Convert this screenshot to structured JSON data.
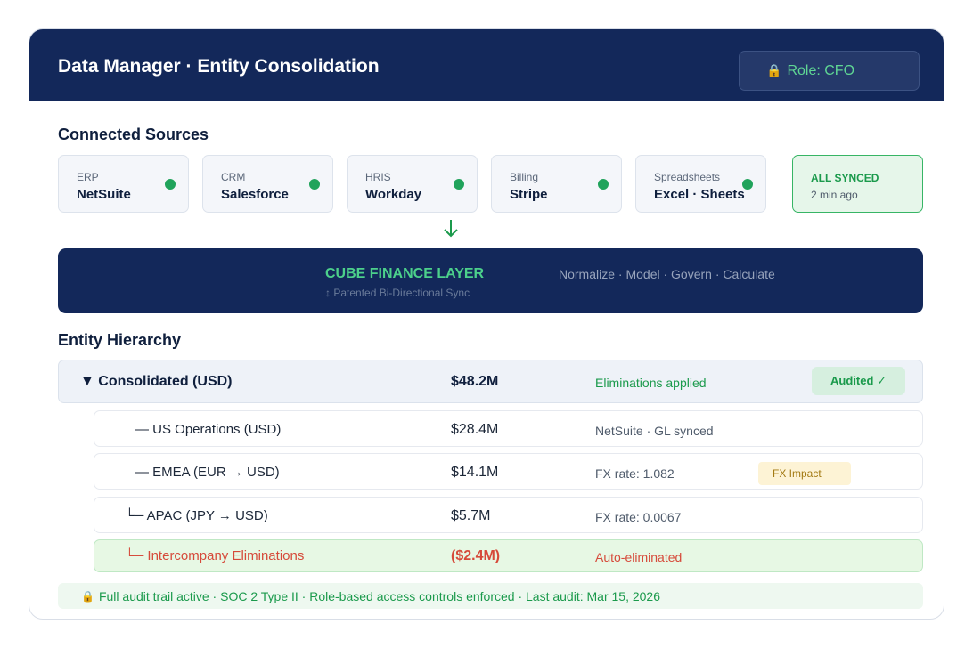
{
  "header": {
    "title": "Data Manager · Entity Consolidation",
    "role_label": "Role: CFO",
    "role_icon": "lock-icon"
  },
  "sources": {
    "title": "Connected Sources",
    "items": [
      {
        "category": "ERP",
        "name": "NetSuite",
        "status": "connected"
      },
      {
        "category": "CRM",
        "name": "Salesforce",
        "status": "connected"
      },
      {
        "category": "HRIS",
        "name": "Workday",
        "status": "connected"
      },
      {
        "category": "Billing",
        "name": "Stripe",
        "status": "connected"
      },
      {
        "category": "Spreadsheets",
        "name": "Excel · Sheets",
        "status": "connected"
      }
    ],
    "sync_status": {
      "title": "ALL SYNCED",
      "time": "2 min ago"
    }
  },
  "cube": {
    "title": "CUBE FINANCE LAYER",
    "subtitle": "↕ Patented Bi-Directional Sync",
    "tagline": "Normalize · Model · Govern · Calculate"
  },
  "hierarchy": {
    "title": "Entity Hierarchy",
    "consolidated": {
      "name": "▼ Consolidated (USD)",
      "value": "$48.2M",
      "note": "Eliminations applied",
      "badge": "Audited ✓"
    },
    "children": [
      {
        "name": "— US Operations (USD)",
        "value": "$28.4M",
        "note": "NetSuite · GL synced"
      },
      {
        "name": "— EMEA (EUR → USD)",
        "value": "$14.1M",
        "note": "FX rate: 1.082",
        "badge": "FX Impact"
      },
      {
        "name": "└─ APAC (JPY → USD)",
        "value": "$5.7M",
        "note": "FX rate: 0.0067"
      }
    ],
    "eliminations": {
      "name": "└─ Intercompany Eliminations",
      "value": "($2.4M)",
      "note": "Auto-eliminated"
    }
  },
  "footer": {
    "audit_text": "Full audit trail active · SOC 2 Type II · Role-based access controls enforced · Last audit: Mar 15, 2026",
    "icon": "lock-icon"
  },
  "colors": {
    "navy": "#13285a",
    "accent_green": "#1b9a4c",
    "status_dot": "#20a35b",
    "elimination_red": "#d64a3a",
    "fx_amber": "#a37a13"
  }
}
